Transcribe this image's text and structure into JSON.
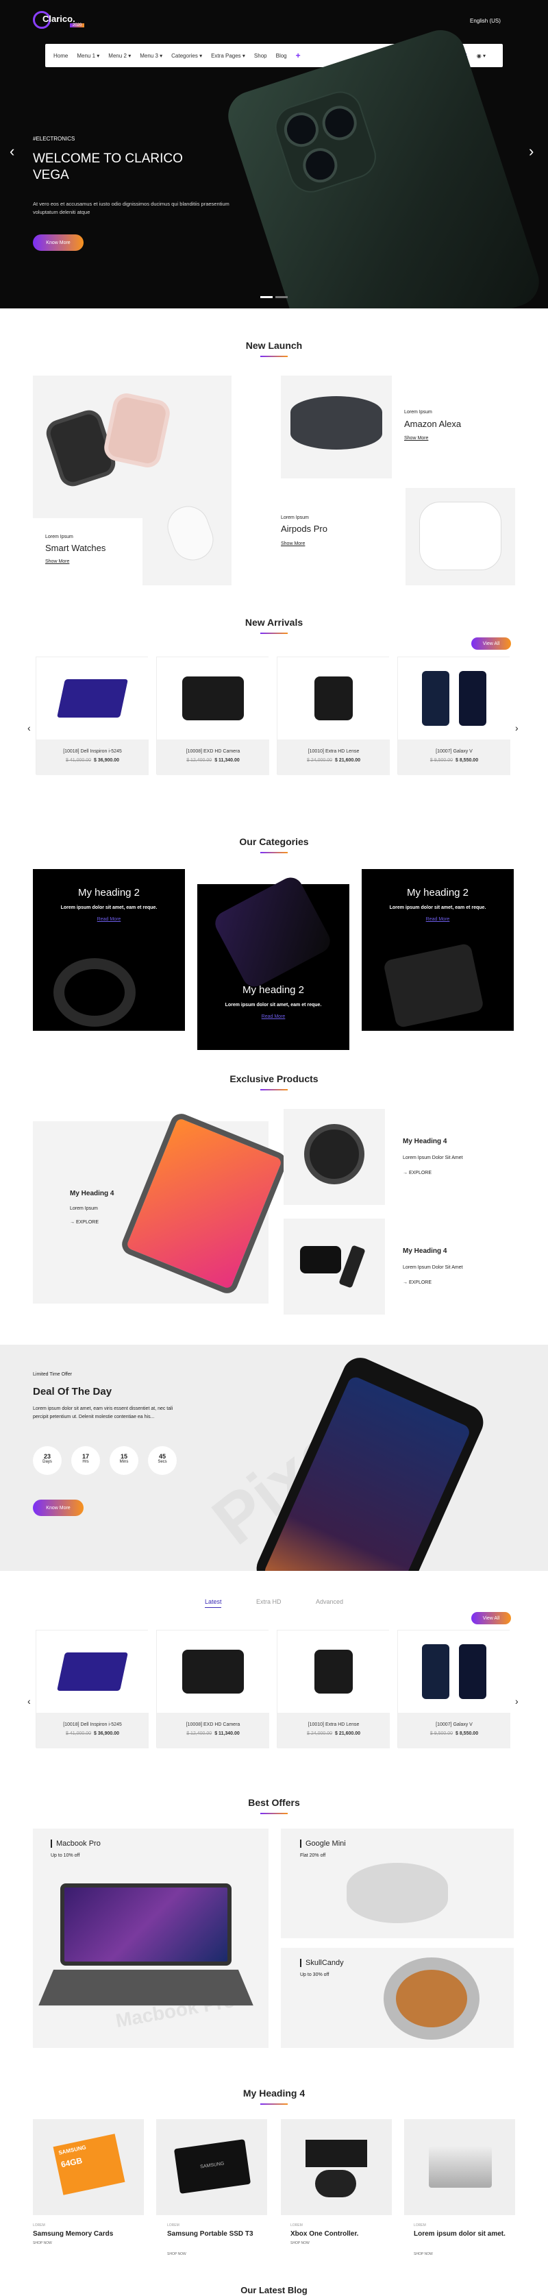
{
  "header": {
    "logo_text": "Clarico.",
    "logo_badge": "2020",
    "language": "English (US)",
    "menu": [
      "Home",
      "Menu 1",
      "Menu 2",
      "Menu 3",
      "Categories",
      "Extra Pages",
      "Shop",
      "Blog"
    ],
    "cart_count": "0",
    "wishlist_count": "0",
    "compare_count": "0"
  },
  "hero": {
    "tag": "#ELECTRONICS",
    "title_line1": "WELCOME TO CLARICO",
    "title_line2": "VEGA",
    "text": "At vero eos et accusamus et iusto odio dignissimos ducimus qui blanditiis praesentium voluptatum deleniti atque",
    "button": "Know More",
    "prev": "‹",
    "next": "›"
  },
  "new_launch": {
    "title": "New Launch",
    "items": [
      {
        "small": "Lorem Ipsum",
        "name": "Smart Watches",
        "link": "Show More"
      },
      {
        "small": "Lorem Ipsum",
        "name": "Amazon Alexa",
        "link": "Show More"
      },
      {
        "small": "Lorem Ipsum",
        "name": "Airpods Pro",
        "link": "Show More"
      }
    ]
  },
  "new_arrivals": {
    "title": "New Arrivals",
    "view_all": "View All",
    "products": [
      {
        "name": "[10018] Dell Inspiron i-5245",
        "old": "$ 41,000.00",
        "price": "$ 36,900.00"
      },
      {
        "name": "[10008] EXD HD Camera",
        "old": "$ 12,400.00",
        "price": "$ 11,340.00"
      },
      {
        "name": "[10010] Extra HD Lense",
        "old": "$ 24,000.00",
        "price": "$ 21,600.00"
      },
      {
        "name": "[10007] Galaxy V",
        "old": "$ 9,500.00",
        "price": "$ 8,550.00"
      }
    ]
  },
  "categories": {
    "title": "Our Categories",
    "boxes": [
      {
        "heading": "My heading 2",
        "text": "Lorem ipsum dolor sit amet, eam et reque.",
        "link": "Read More"
      },
      {
        "heading": "My heading 2",
        "text": "Lorem ipsum dolor sit amet, eam et reque.",
        "link": "Read More"
      },
      {
        "heading": "My heading 2",
        "text": "Lorem ipsum dolor sit amet, eam et reque.",
        "link": "Read More"
      }
    ]
  },
  "exclusive": {
    "title": "Exclusive Products",
    "big": {
      "heading": "My Heading 4",
      "sub": "Lorem Ipsum",
      "link": "EXPLORE"
    },
    "items": [
      {
        "heading": "My Heading 4",
        "sub": "Lorem Ipsum Dolor Sit Amet",
        "link": "EXPLORE"
      },
      {
        "heading": "My Heading 4",
        "sub": "Lorem Ipsum Dolor Sit Amet",
        "link": "EXPLORE"
      }
    ]
  },
  "deal": {
    "tag": "Limited Time Offer",
    "title": "Deal Of The Day",
    "text": "Lorem ipsum dolor sit amet, eam viris essent dissentiet at, nec tali percipit petentium ut. Delenit molestie contentiae ea his...",
    "countdown": [
      {
        "value": "23",
        "label": "Days"
      },
      {
        "value": "17",
        "label": "Hrs"
      },
      {
        "value": "15",
        "label": "Mins"
      },
      {
        "value": "45",
        "label": "Secs"
      }
    ],
    "button": "Know More",
    "watermark": "Pixel"
  },
  "tabs": {
    "items": [
      "Latest",
      "Extra HD",
      "Advanced"
    ],
    "active": "Latest",
    "view_all": "View All",
    "products": [
      {
        "name": "[10018] Dell Inspiron i-5245",
        "old": "$ 41,000.00",
        "price": "$ 36,900.00"
      },
      {
        "name": "[10008] EXD HD Camera",
        "old": "$ 12,400.00",
        "price": "$ 11,340.00"
      },
      {
        "name": "[10010] Extra HD Lense",
        "old": "$ 24,000.00",
        "price": "$ 21,600.00"
      },
      {
        "name": "[10007] Galaxy V",
        "old": "$ 9,500.00",
        "price": "$ 8,550.00"
      }
    ]
  },
  "best_offers": {
    "title": "Best Offers",
    "items": [
      {
        "name": "Macbook Pro",
        "offer": "Up to 10% off",
        "watermark": "Macbook Pro"
      },
      {
        "name": "Google Mini",
        "offer": "Flat 20% off"
      },
      {
        "name": "SkullCandy",
        "offer": "Up to 30% off"
      }
    ]
  },
  "heading4": {
    "title": "My Heading 4",
    "items": [
      {
        "small": "LOREM",
        "name": "Samsung Memory Cards",
        "link": "SHOP NOW",
        "card_text": "SAMSUNG",
        "card_cap": "64GB"
      },
      {
        "small": "LOREM",
        "name": "Samsung Portable SSD T3",
        "link": "SHOP NOW",
        "card_text": "SAMSUNG"
      },
      {
        "small": "LOREM",
        "name": "Xbox One Controller.",
        "link": "SHOP NOW"
      },
      {
        "small": "LOREM",
        "name": "Lorem ipsum dolor sit amet.",
        "link": "SHOP NOW"
      }
    ]
  },
  "blog": {
    "title": "Our Latest Blog"
  },
  "colors": {
    "accent_purple": "#7b2ff7",
    "accent_orange": "#f7931e"
  }
}
